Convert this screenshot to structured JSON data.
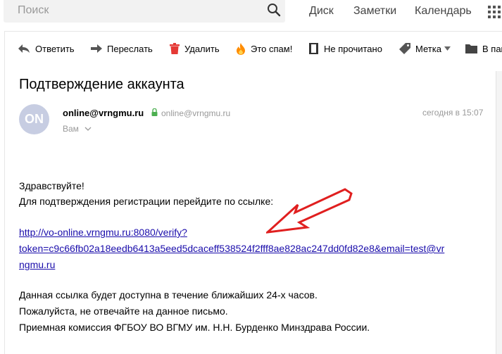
{
  "header": {
    "search": {
      "placeholder": "Поиск"
    },
    "services": [
      {
        "label": "Диск"
      },
      {
        "label": "Заметки"
      },
      {
        "label": "Календарь"
      }
    ]
  },
  "toolbar": {
    "reply": "Ответить",
    "forward": "Переслать",
    "delete": "Удалить",
    "spam": "Это спам!",
    "unread": "Не прочитано",
    "label": "Метка",
    "move_to": "В пап"
  },
  "message": {
    "subject": "Подтверждение аккаунта",
    "avatar_initials": "ON",
    "sender_name": "online@vrngmu.ru",
    "sender_email": "online@vrngmu.ru",
    "date": "сегодня в 15:07",
    "recipient": "Вам",
    "body": {
      "greeting": "Здравствуйте!",
      "instruction": "Для подтверждения регистрации перейдите по ссылке:",
      "link_lines": [
        "http://vo-online.vrngmu.ru:8080/verify?",
        "token=c9c66fb02a18eedb6413a5eed5dcaceff538524f2fff8ae828ac247dd0fd82e8&email=test@vr",
        "ngmu.ru"
      ],
      "notice_lines": [
        "Данная ссылка будет доступна в течение ближайших 24-х часов.",
        "Пожалуйста, не отвечайте на данное письмо.",
        "Приемная комиссия ФГБОУ ВО ВГМУ им. Н.Н. Бурденко Минздрава России."
      ]
    }
  },
  "colors": {
    "link": "#1a0dab",
    "arrow": "#e01f1f",
    "avatar_bg": "#c7cde2",
    "delete_icon": "#e53935",
    "spam_icon": "#ff8c00",
    "secure_lock": "#4caf50"
  }
}
